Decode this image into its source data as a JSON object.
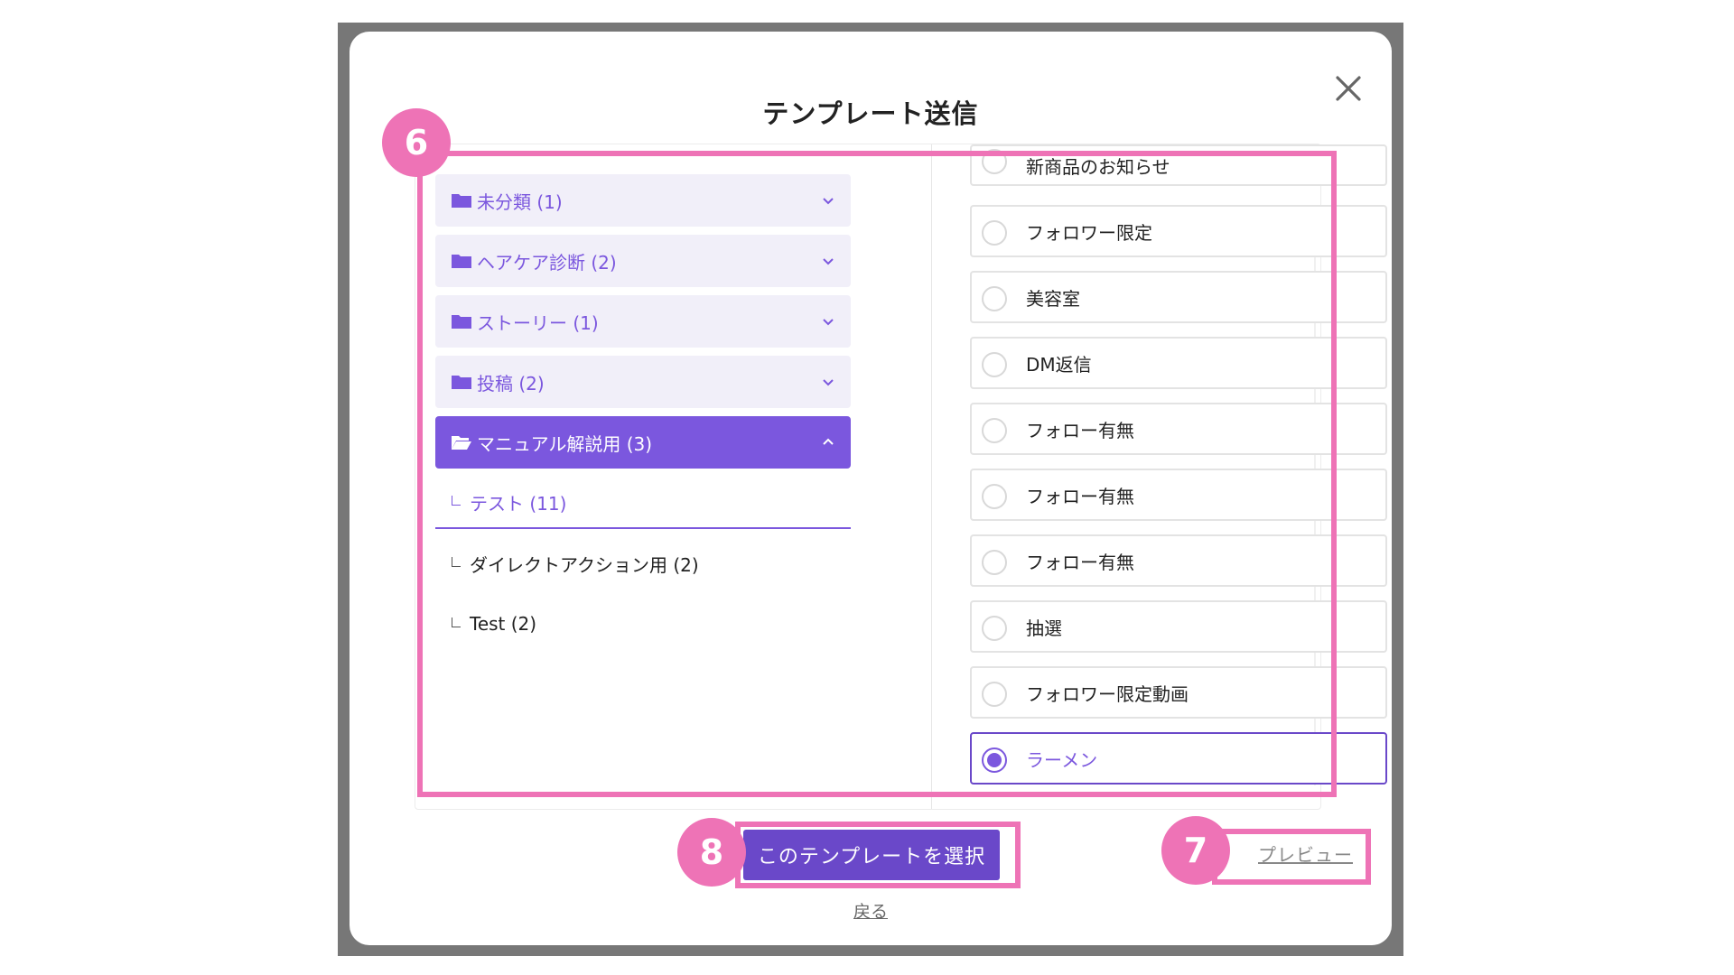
{
  "modal": {
    "title": "テンプレート送信"
  },
  "folders": [
    {
      "label": "未分類 (1)",
      "active": false
    },
    {
      "label": "ヘアケア診断 (2)",
      "active": false
    },
    {
      "label": "ストーリー (1)",
      "active": false
    },
    {
      "label": "投稿 (2)",
      "active": false
    },
    {
      "label": "マニュアル解説用 (3)",
      "active": true
    }
  ],
  "subfolders": [
    {
      "label": "テスト (11)",
      "selected": true
    },
    {
      "label": "ダイレクトアクション用 (2)",
      "selected": false
    },
    {
      "label": "Test (2)",
      "selected": false
    }
  ],
  "templates": [
    {
      "label": "新商品のお知らせ",
      "selected": false
    },
    {
      "label": "フォロワー限定",
      "selected": false
    },
    {
      "label": "美容室",
      "selected": false
    },
    {
      "label": "DM返信",
      "selected": false
    },
    {
      "label": "フォロー有無",
      "selected": false
    },
    {
      "label": "フォロー有無",
      "selected": false
    },
    {
      "label": "フォロー有無",
      "selected": false
    },
    {
      "label": "抽選",
      "selected": false
    },
    {
      "label": "フォロワー限定動画",
      "selected": false
    },
    {
      "label": "ラーメン",
      "selected": true
    }
  ],
  "actions": {
    "select_label": "このテンプレートを選択",
    "back_label": "戻る",
    "preview_label": "プレビュー"
  },
  "annotations": {
    "list_badge": "6",
    "preview_badge": "7",
    "select_badge": "8"
  },
  "colors": {
    "accent": "#7b57de",
    "accent_dark": "#6a48c9",
    "folder_bg": "#f1eff9",
    "annotation_pink": "#ee73b6"
  },
  "icons": {
    "close": "close-icon",
    "folder": "folder-icon",
    "folder_open": "folder-open-icon",
    "chevron_down": "chevron-down-icon",
    "chevron_up": "chevron-up-icon"
  }
}
